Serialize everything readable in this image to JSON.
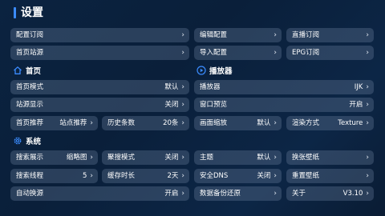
{
  "page": {
    "title": "设置"
  },
  "chevron": "›",
  "top_row_1": [
    {
      "label": "配置订阅"
    },
    {
      "label": "编辑配置"
    },
    {
      "label": "直播订阅"
    }
  ],
  "top_row_2": [
    {
      "label": "首页站源"
    },
    {
      "label": "导入配置"
    },
    {
      "label": "EPG订阅"
    }
  ],
  "sections": {
    "home": {
      "title": "首页",
      "icon": "home-icon"
    },
    "player": {
      "title": "播放器",
      "icon": "play-circle-icon"
    },
    "system": {
      "title": "系统",
      "icon": "gear-icon"
    }
  },
  "home_items": {
    "home_mode": {
      "label": "首页模式",
      "value": "默认"
    },
    "source_display": {
      "label": "站源显示",
      "value": "关闭"
    },
    "home_recommend": {
      "label": "首页推荐",
      "value": "站点推荐"
    },
    "history_count": {
      "label": "历史条数",
      "value": "20条"
    }
  },
  "player_items": {
    "player": {
      "label": "播放器",
      "value": "IJK"
    },
    "window_preview": {
      "label": "窗口预览",
      "value": "开启"
    },
    "aspect": {
      "label": "画面缩放",
      "value": "默认"
    },
    "render": {
      "label": "渲染方式",
      "value": "Texture"
    }
  },
  "system_items": {
    "search_display": {
      "label": "搜索展示",
      "value": "缩略图"
    },
    "aggregate_search": {
      "label": "聚搜模式",
      "value": "关闭"
    },
    "theme": {
      "label": "主题",
      "value": "默认"
    },
    "change_wallpaper": {
      "label": "换张壁纸"
    },
    "search_threads": {
      "label": "搜索线程",
      "value": "5"
    },
    "cache_duration": {
      "label": "缓存时长",
      "value": "2天"
    },
    "secure_dns": {
      "label": "安全DNS",
      "value": "关闭"
    },
    "reset_wallpaper": {
      "label": "重置壁纸"
    },
    "auto_switch": {
      "label": "自动换源",
      "value": "开启"
    },
    "backup": {
      "label": "数据备份还原"
    },
    "about": {
      "label": "关于",
      "value": "V3.10"
    }
  },
  "colors": {
    "accent": "#3b8cff",
    "button_bg": "rgba(120,140,170,0.30)"
  }
}
